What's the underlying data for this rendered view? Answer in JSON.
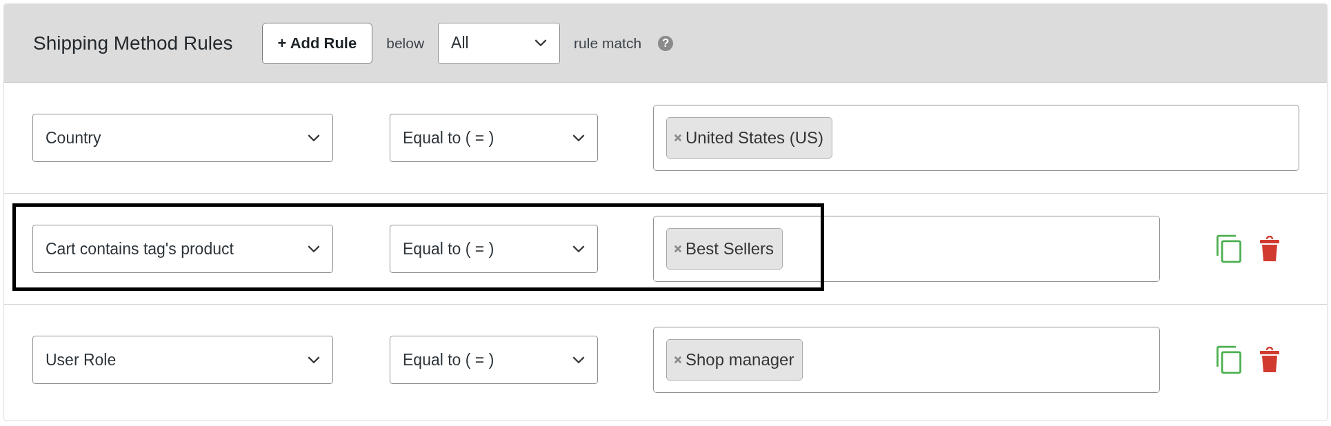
{
  "header": {
    "title": "Shipping Method Rules",
    "add_button": "+ Add Rule",
    "below_label": "below",
    "match_select": "All",
    "match_label": "rule match",
    "help_icon": "?"
  },
  "rules": [
    {
      "field": "Country",
      "operator": "Equal to ( = )",
      "tags": [
        "United States (US)"
      ],
      "actions": false,
      "highlighted": false
    },
    {
      "field": "Cart contains tag's product",
      "operator": "Equal to ( = )",
      "tags": [
        "Best Sellers"
      ],
      "actions": true,
      "highlighted": true
    },
    {
      "field": "User Role",
      "operator": "Equal to ( = )",
      "tags": [
        "Shop manager"
      ],
      "actions": true,
      "highlighted": false
    }
  ]
}
